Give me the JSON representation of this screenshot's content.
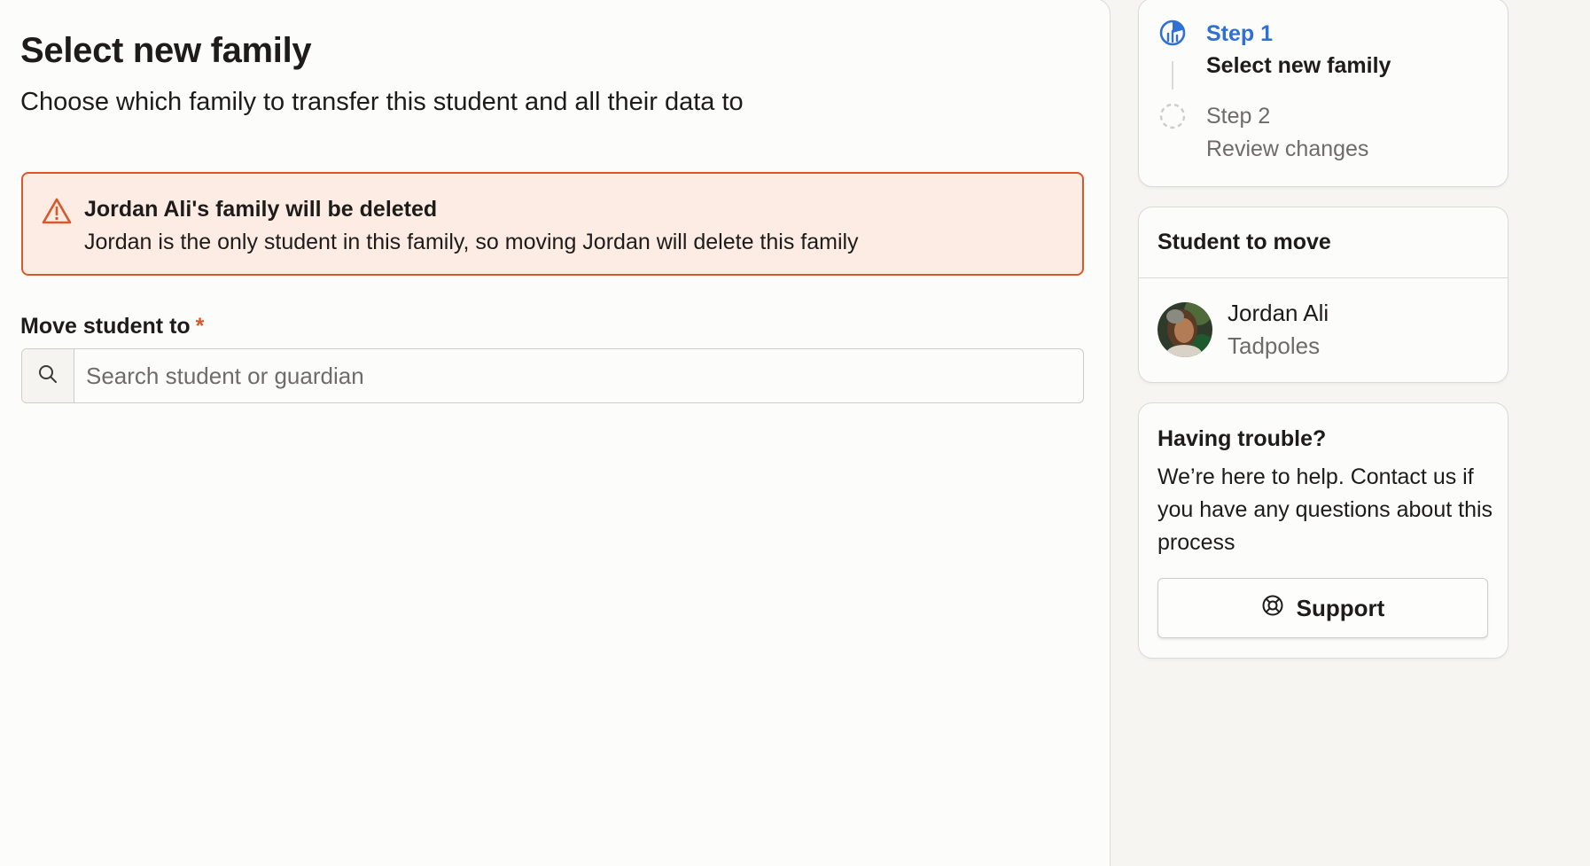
{
  "main": {
    "title": "Select new family",
    "subtitle": "Choose which family to transfer this student and all their data to",
    "alert": {
      "title": "Jordan Ali's family will be deleted",
      "message": "Jordan is the only student in this family, so moving Jordan will delete this family",
      "icon": "warning-triangle-icon",
      "color": "#d9572a",
      "background": "#fdece4"
    },
    "move_field": {
      "label": "Move student to",
      "required_mark": "*",
      "placeholder": "Search student or guardian",
      "value": "",
      "icon": "search-icon"
    }
  },
  "sidebar": {
    "steps": [
      {
        "number": "Step 1",
        "label": "Select new family",
        "state": "active",
        "icon": "progress-circle-icon"
      },
      {
        "number": "Step 2",
        "label": "Review changes",
        "state": "pending",
        "icon": "dashed-circle-icon"
      }
    ],
    "student_card": {
      "title": "Student to move",
      "name": "Jordan Ali",
      "class": "Tadpoles",
      "avatar": "student-avatar"
    },
    "help_card": {
      "title": "Having trouble?",
      "text": "We’re here to help. Contact us if you have any questions about this process",
      "button_label": "Support",
      "button_icon": "lifebuoy-icon"
    }
  },
  "colors": {
    "accent": "#2f6fd6",
    "danger": "#d9572a",
    "muted": "#6e6c68"
  }
}
